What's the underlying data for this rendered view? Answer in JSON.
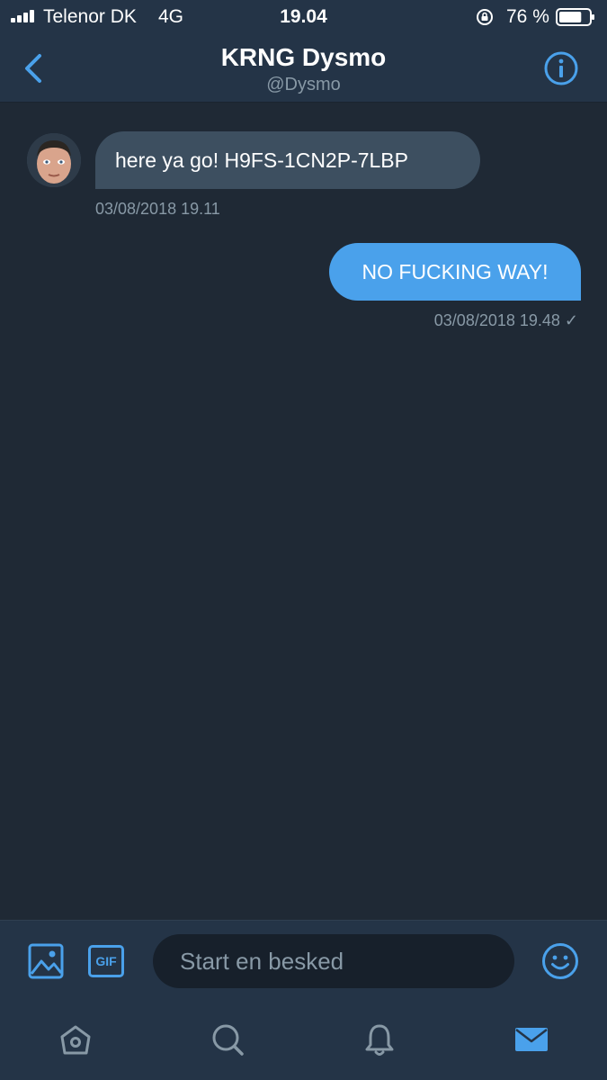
{
  "status_bar": {
    "carrier": "Telenor DK",
    "network": "4G",
    "time": "19.04",
    "battery_percent": "76 %",
    "battery_level": 0.76
  },
  "header": {
    "title": "KRNG Dysmo",
    "handle": "@Dysmo"
  },
  "messages": [
    {
      "direction": "incoming",
      "text": "here ya go! H9FS-1CN2P-7LBP",
      "timestamp": "03/08/2018 19.11"
    },
    {
      "direction": "outgoing",
      "text": "NO FUCKING WAY!",
      "timestamp": "03/08/2018 19.48 ✓"
    }
  ],
  "composer": {
    "placeholder": "Start en besked",
    "gif_label": "GIF"
  },
  "tabs": [
    {
      "name": "home-icon",
      "active": false
    },
    {
      "name": "search-icon",
      "active": false
    },
    {
      "name": "bell-icon",
      "active": false
    },
    {
      "name": "mail-icon",
      "active": true
    }
  ],
  "colors": {
    "background": "#1f2935",
    "bar": "#243447",
    "accent": "#4aa1eb",
    "incoming_bubble": "#3d4f60",
    "muted_text": "#8899a6"
  }
}
